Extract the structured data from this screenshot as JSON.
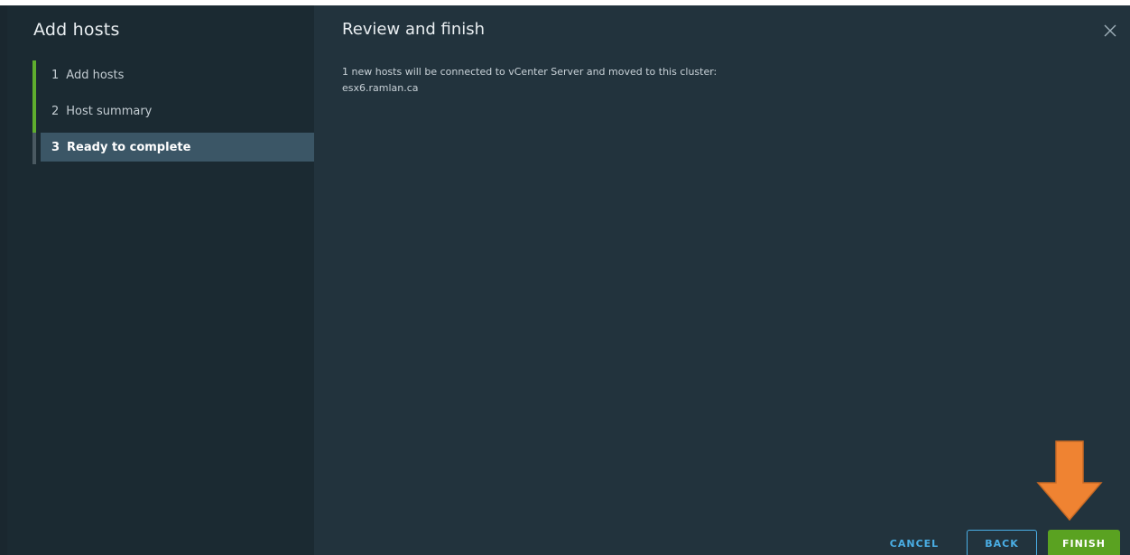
{
  "wizard": {
    "title": "Add hosts",
    "steps": [
      {
        "number": "1",
        "label": "Add hosts",
        "state": "completed"
      },
      {
        "number": "2",
        "label": "Host summary",
        "state": "completed"
      },
      {
        "number": "3",
        "label": "Ready to complete",
        "state": "active"
      }
    ]
  },
  "main": {
    "title": "Review and finish",
    "message": "1 new hosts will be connected to vCenter Server and moved to this cluster:",
    "host": "esx6.ramlan.ca"
  },
  "footer": {
    "cancel_label": "CANCEL",
    "back_label": "BACK",
    "finish_label": "FINISH"
  },
  "icons": {
    "close": "close-icon",
    "annotation": "down-arrow-annotation"
  },
  "colors": {
    "accent_green": "#5aa221",
    "link_blue": "#4aaee5",
    "annotation_orange": "#ef8332"
  }
}
